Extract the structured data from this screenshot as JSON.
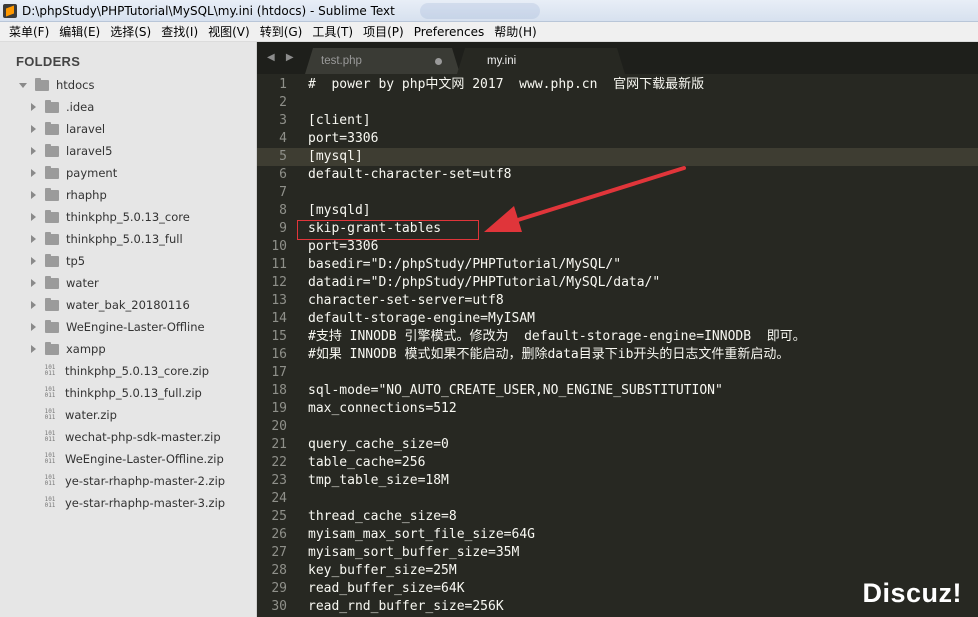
{
  "window": {
    "title": "D:\\phpStudy\\PHPTutorial\\MySQL\\my.ini (htdocs) - Sublime Text"
  },
  "menu": [
    "菜单(F)",
    "编辑(E)",
    "选择(S)",
    "查找(I)",
    "视图(V)",
    "转到(G)",
    "工具(T)",
    "项目(P)",
    "Preferences",
    "帮助(H)"
  ],
  "sidebar": {
    "title": "FOLDERS",
    "root": "htdocs",
    "folders": [
      ".idea",
      "laravel",
      "laravel5",
      "payment",
      "rhaphp",
      "thinkphp_5.0.13_core",
      "thinkphp_5.0.13_full",
      "tp5",
      "water",
      "water_bak_20180116",
      "WeEngine-Laster-Offline",
      "xampp"
    ],
    "files": [
      "thinkphp_5.0.13_core.zip",
      "thinkphp_5.0.13_full.zip",
      "water.zip",
      "wechat-php-sdk-master.zip",
      "WeEngine-Laster-Offline.zip",
      "ye-star-rhaphp-master-2.zip",
      "ye-star-rhaphp-master-3.zip"
    ],
    "file_icon_text": "101\n011"
  },
  "tabs": {
    "nav": "◀ ▶",
    "items": [
      {
        "label": "test.php",
        "active": false,
        "dirty": true
      },
      {
        "label": "my.ini",
        "active": true,
        "dirty": false
      }
    ]
  },
  "editor": {
    "current_line": 5,
    "highlighted_line": 9,
    "lines": [
      "#  power by php中文网 2017  www.php.cn  官网下载最新版",
      "",
      "[client]",
      "port=3306",
      "[mysql]",
      "default-character-set=utf8",
      "",
      "[mysqld]",
      "skip-grant-tables",
      "port=3306",
      "basedir=\"D:/phpStudy/PHPTutorial/MySQL/\"",
      "datadir=\"D:/phpStudy/PHPTutorial/MySQL/data/\"",
      "character-set-server=utf8",
      "default-storage-engine=MyISAM",
      "#支持 INNODB 引擎模式。修改为  default-storage-engine=INNODB  即可。",
      "#如果 INNODB 模式如果不能启动，删除data目录下ib开头的日志文件重新启动。",
      "",
      "sql-mode=\"NO_AUTO_CREATE_USER,NO_ENGINE_SUBSTITUTION\"",
      "max_connections=512",
      "",
      "query_cache_size=0",
      "table_cache=256",
      "tmp_table_size=18M",
      "",
      "thread_cache_size=8",
      "myisam_max_sort_file_size=64G",
      "myisam_sort_buffer_size=35M",
      "key_buffer_size=25M",
      "read_buffer_size=64K",
      "read_rnd_buffer_size=256K"
    ]
  },
  "annotation": {
    "color": "#e0353a"
  },
  "watermark": "Discuz!"
}
